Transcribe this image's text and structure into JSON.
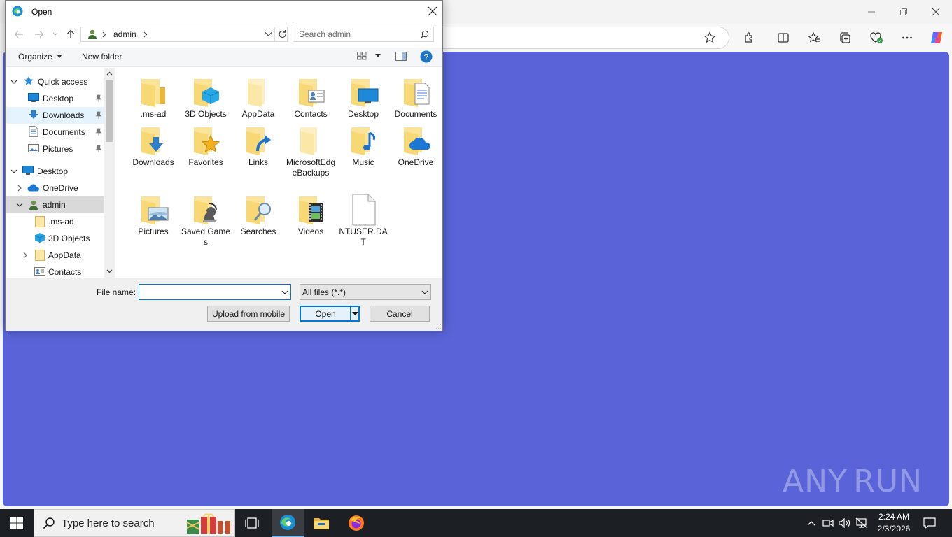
{
  "browser": {
    "window_controls": {
      "minimize": "minimize",
      "restore": "restore",
      "close": "close"
    },
    "toolbar_icons": [
      "favorite-star-icon",
      "extensions-icon",
      "split-screen-icon",
      "favorites-icon",
      "collections-icon",
      "performance-icon",
      "more-icon",
      "copilot-icon"
    ],
    "page_background": "#5a64d8",
    "watermark": "ANY RUN"
  },
  "dialog": {
    "title": "Open",
    "path": {
      "segments": [
        "admin"
      ]
    },
    "search": {
      "placeholder": "Search admin",
      "value": ""
    },
    "commands": {
      "organize": "Organize",
      "new_folder": "New folder"
    },
    "nav": {
      "items": [
        {
          "label": "Quick access",
          "icon": "star-icon",
          "expanded": true,
          "pinned": false
        },
        {
          "label": "Desktop",
          "icon": "desktop-icon",
          "pinned": true
        },
        {
          "label": "Downloads",
          "icon": "downloads-icon",
          "pinned": true
        },
        {
          "label": "Documents",
          "icon": "documents-icon",
          "pinned": true
        },
        {
          "label": "Pictures",
          "icon": "pictures-icon",
          "pinned": true
        },
        {
          "label": "Desktop",
          "icon": "desktop-icon",
          "expanded": true
        },
        {
          "label": "OneDrive",
          "icon": "onedrive-icon",
          "expanded": false
        },
        {
          "label": "admin",
          "icon": "user-icon",
          "expanded": true
        },
        {
          "label": ".ms-ad",
          "icon": "folder-icon"
        },
        {
          "label": "3D Objects",
          "icon": "3d-objects-icon"
        },
        {
          "label": "AppData",
          "icon": "folder-icon",
          "expanded": false
        },
        {
          "label": "Contacts",
          "icon": "contacts-icon"
        }
      ]
    },
    "files": [
      {
        "label": ".ms-ad",
        "icon": "folder-icon"
      },
      {
        "label": "3D Objects",
        "icon": "3d-objects-folder-icon"
      },
      {
        "label": "AppData",
        "icon": "folder-icon"
      },
      {
        "label": "Contacts",
        "icon": "contacts-folder-icon"
      },
      {
        "label": "Desktop",
        "icon": "desktop-folder-icon"
      },
      {
        "label": "Documents",
        "icon": "documents-folder-icon"
      },
      {
        "label": "Downloads",
        "icon": "downloads-folder-icon"
      },
      {
        "label": "Favorites",
        "icon": "favorites-folder-icon"
      },
      {
        "label": "Links",
        "icon": "links-folder-icon"
      },
      {
        "label": "MicrosoftEdgeBackups",
        "icon": "folder-icon"
      },
      {
        "label": "Music",
        "icon": "music-folder-icon"
      },
      {
        "label": "OneDrive",
        "icon": "onedrive-folder-icon"
      },
      {
        "label": "Pictures",
        "icon": "pictures-folder-icon"
      },
      {
        "label": "Saved Games",
        "icon": "saved-games-folder-icon"
      },
      {
        "label": "Searches",
        "icon": "searches-folder-icon"
      },
      {
        "label": "Videos",
        "icon": "videos-folder-icon"
      },
      {
        "label": "NTUSER.DAT",
        "icon": "file-icon"
      }
    ],
    "file_name": {
      "label": "File name:",
      "value": ""
    },
    "filter": {
      "selected": "All files (*.*)"
    },
    "buttons": {
      "upload": "Upload from mobile",
      "open": "Open",
      "cancel": "Cancel"
    }
  },
  "taskbar": {
    "search_placeholder": "Type here to search",
    "apps": [
      "task-view-icon",
      "edge-icon",
      "file-explorer-icon",
      "firefox-icon"
    ],
    "time": "2:24 AM",
    "date": "2/3/2026"
  },
  "colors": {
    "accent": "#0078d7",
    "folder": "#f8d775",
    "selection": "#cce8ff"
  }
}
